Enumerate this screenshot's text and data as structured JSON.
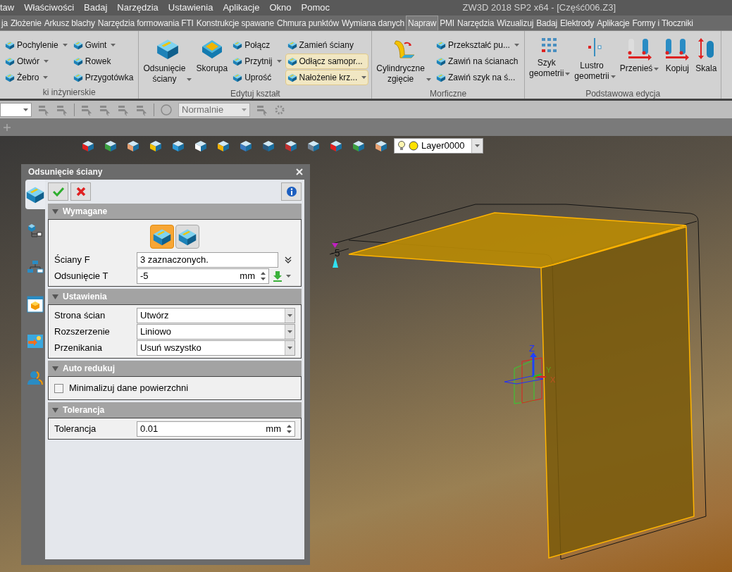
{
  "menu_bar": {
    "items": [
      "taw",
      "Właściwości",
      "Badaj",
      "Narzędzia",
      "Ustawienia",
      "Aplikacje",
      "Okno",
      "Pomoc"
    ],
    "title": "ZW3D 2018 SP2 x64 - [Część006.Z3]"
  },
  "ribbon_tabs": [
    {
      "label": "ja",
      "selected": false
    },
    {
      "label": "Złożenie",
      "selected": false
    },
    {
      "label": "Arkusz blachy",
      "selected": false
    },
    {
      "label": "Narzędzia formowania FTI",
      "selected": false
    },
    {
      "label": "Konstrukcje spawane",
      "selected": false
    },
    {
      "label": "Chmura punktów",
      "selected": false
    },
    {
      "label": "Wymiana danych",
      "selected": false
    },
    {
      "label": "Napraw",
      "selected": true
    },
    {
      "label": "PMI",
      "selected": false
    },
    {
      "label": "Narzędzia",
      "selected": false
    },
    {
      "label": "Wizualizuj",
      "selected": false
    },
    {
      "label": "Badaj",
      "selected": false
    },
    {
      "label": "Elektrody",
      "selected": false
    },
    {
      "label": "Aplikacje",
      "selected": false
    },
    {
      "label": "Formy i Tłoczniki",
      "selected": false
    }
  ],
  "ribbon_groups": [
    {
      "label": "ki inżynierskie",
      "columns": [
        [
          {
            "label": "Pochylenie",
            "dropdown": true,
            "highlighted": false
          },
          {
            "label": "Otwór",
            "dropdown": true,
            "highlighted": false
          },
          {
            "label": "Żebro",
            "dropdown": true,
            "highlighted": false
          }
        ],
        [
          {
            "label": "Gwint",
            "dropdown": true,
            "highlighted": false
          },
          {
            "label": "Rowek",
            "dropdown": false,
            "highlighted": false
          },
          {
            "label": "Przygotówka",
            "dropdown": false,
            "highlighted": false
          }
        ]
      ]
    },
    {
      "label": "Edytuj kształt",
      "large": [
        {
          "label": "Odsunięcie ściany",
          "dropdown": true
        },
        {
          "label": "Skorupa",
          "dropdown": false
        }
      ],
      "columns": [
        [
          {
            "label": "Połącz",
            "dropdown": false,
            "highlighted": false
          },
          {
            "label": "Przytnij",
            "dropdown": true,
            "highlighted": false
          },
          {
            "label": "Uprość",
            "dropdown": false,
            "highlighted": false
          }
        ],
        [
          {
            "label": "Zamień ściany",
            "dropdown": false,
            "highlighted": false
          },
          {
            "label": "Odłącz samopr...",
            "dropdown": false,
            "highlighted": true
          },
          {
            "label": "Nałożenie krz...",
            "dropdown": true,
            "highlighted": true
          }
        ]
      ]
    },
    {
      "label": "Morficzne",
      "large": [
        {
          "label": "Cylindryczne zgięcie",
          "dropdown": true
        }
      ],
      "columns": [
        [
          {
            "label": "Przekształć pu...",
            "dropdown": true,
            "highlighted": false
          },
          {
            "label": "Zawiń na ścianach",
            "dropdown": false,
            "highlighted": false
          },
          {
            "label": "Zawiń szyk na ś...",
            "dropdown": false,
            "highlighted": false
          }
        ]
      ]
    },
    {
      "label": "Podstawowa edycja",
      "large": [
        {
          "label": "Szyk geometrii",
          "dropdown": true
        },
        {
          "label": "Lustro geometrii",
          "dropdown": true
        },
        {
          "label": "Przenieś",
          "dropdown": true
        },
        {
          "label": "Kopiuj",
          "dropdown": false
        },
        {
          "label": "Skala",
          "dropdown": false
        }
      ]
    }
  ],
  "toolbar": {
    "mode": {
      "value": "Normalnie",
      "disabled": true
    }
  },
  "viewport": {
    "layer": "Layer0000",
    "dimension": "-5",
    "axes": [
      "X",
      "Y",
      "Z"
    ]
  },
  "dialog": {
    "title": "Odsunięcie ściany",
    "side_tabs": [
      {
        "selected": true
      },
      {
        "selected": false
      },
      {
        "selected": false
      },
      {
        "selected": false
      },
      {
        "selected": false
      },
      {
        "selected": false
      }
    ],
    "sections": [
      {
        "title": "Wymagane",
        "expanded": true,
        "rows": [
          {
            "kind": "toggle",
            "options": [
              {
                "selected": true
              },
              {
                "selected": false
              }
            ]
          },
          {
            "kind": "text",
            "label": "Ściany F",
            "value": "3 zaznaczonych."
          },
          {
            "kind": "number",
            "label": "Odsunięcie T",
            "value": "-5",
            "unit": "mm"
          }
        ]
      },
      {
        "title": "Ustawienia",
        "expanded": true,
        "rows": [
          {
            "kind": "select",
            "label": "Strona ścian",
            "value": "Utwórz"
          },
          {
            "kind": "select",
            "label": "Rozszerzenie",
            "value": "Liniowo"
          },
          {
            "kind": "select",
            "label": "Przenikania",
            "value": "Usuń wszystko"
          }
        ]
      },
      {
        "title": "Auto redukuj",
        "expanded": true,
        "rows": [
          {
            "kind": "checkbox",
            "label": "Minimalizuj dane powierzchni",
            "checked": false
          }
        ]
      },
      {
        "title": "Tolerancja",
        "expanded": true,
        "rows": [
          {
            "kind": "number",
            "label": "Tolerancja",
            "value": "0.01",
            "unit": "mm"
          }
        ]
      }
    ]
  }
}
